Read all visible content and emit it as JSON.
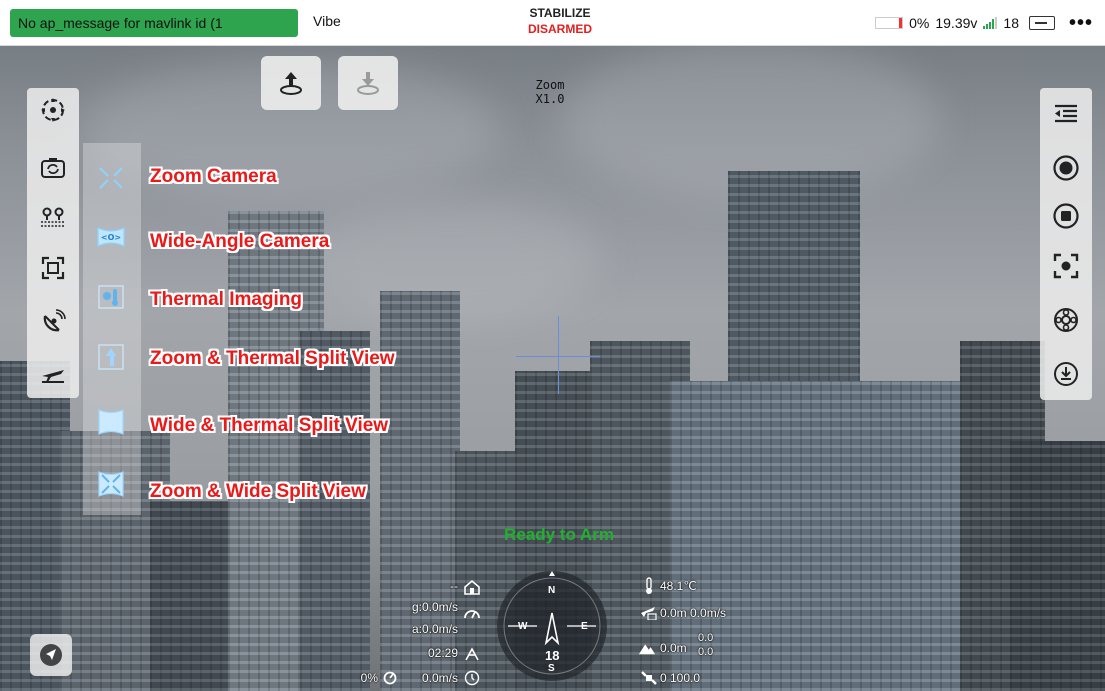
{
  "topbar": {
    "message": "No ap_message for mavlink id (1",
    "vehicle": "Vibe",
    "flight_mode": "STABILIZE",
    "arm_state": "DISARMED",
    "battery_percent": "0%",
    "voltage": "19.39v",
    "satellites": "18",
    "more": "•••",
    "colors": {
      "message_bg": "#2ea44f",
      "disarmed": "#e02020"
    }
  },
  "actions": {
    "takeoff_icon": "takeoff-icon",
    "land_icon": "land-icon"
  },
  "zoom": {
    "label": "Zoom",
    "value": "X1.0"
  },
  "left_toolbar": {
    "items": [
      {
        "icon": "gimbal-center-icon"
      },
      {
        "icon": "camera-switch-icon"
      },
      {
        "icon": "waypoints-icon"
      },
      {
        "icon": "crop-icon"
      },
      {
        "icon": "satellite-dish-icon"
      },
      {
        "icon": "plane-icon"
      }
    ]
  },
  "camera_modes": [
    {
      "label": "Zoom Camera",
      "icon": "zoom-camera-icon"
    },
    {
      "label": "Wide-Angle Camera",
      "icon": "wide-angle-camera-icon"
    },
    {
      "label": "Thermal Imaging",
      "icon": "thermal-icon"
    },
    {
      "label": "Zoom & Thermal Split View",
      "icon": "zoom-thermal-split-icon"
    },
    {
      "label": "Wide & Thermal Split View",
      "icon": "wide-thermal-split-icon"
    },
    {
      "label": "Zoom & Wide Split View",
      "icon": "zoom-wide-split-icon"
    }
  ],
  "right_toolbar": {
    "items": [
      {
        "icon": "menu-collapse-icon"
      },
      {
        "icon": "record-icon"
      },
      {
        "icon": "stop-icon"
      },
      {
        "icon": "focus-icon"
      },
      {
        "icon": "settings-wheel-icon"
      },
      {
        "icon": "download-icon"
      }
    ]
  },
  "status": {
    "ready": "Ready to Arm"
  },
  "telemetry": {
    "home_distance": "--",
    "ground_speed": "g:0.0m/s",
    "air_speed": "a:0.0m/s",
    "flight_time": "02:29",
    "throttle": "0%",
    "vertical_speed": "0.0m/s",
    "temperature": "48.1℃",
    "altitude_speed": "0.0m 0.0m/s",
    "terrain_alt": "0.0m",
    "terrain_a": "0.0",
    "terrain_b": "0.0",
    "gps_value": "0 100.0"
  },
  "compass": {
    "n": "N",
    "s": "S",
    "w": "W",
    "e": "E",
    "heading": "18"
  }
}
